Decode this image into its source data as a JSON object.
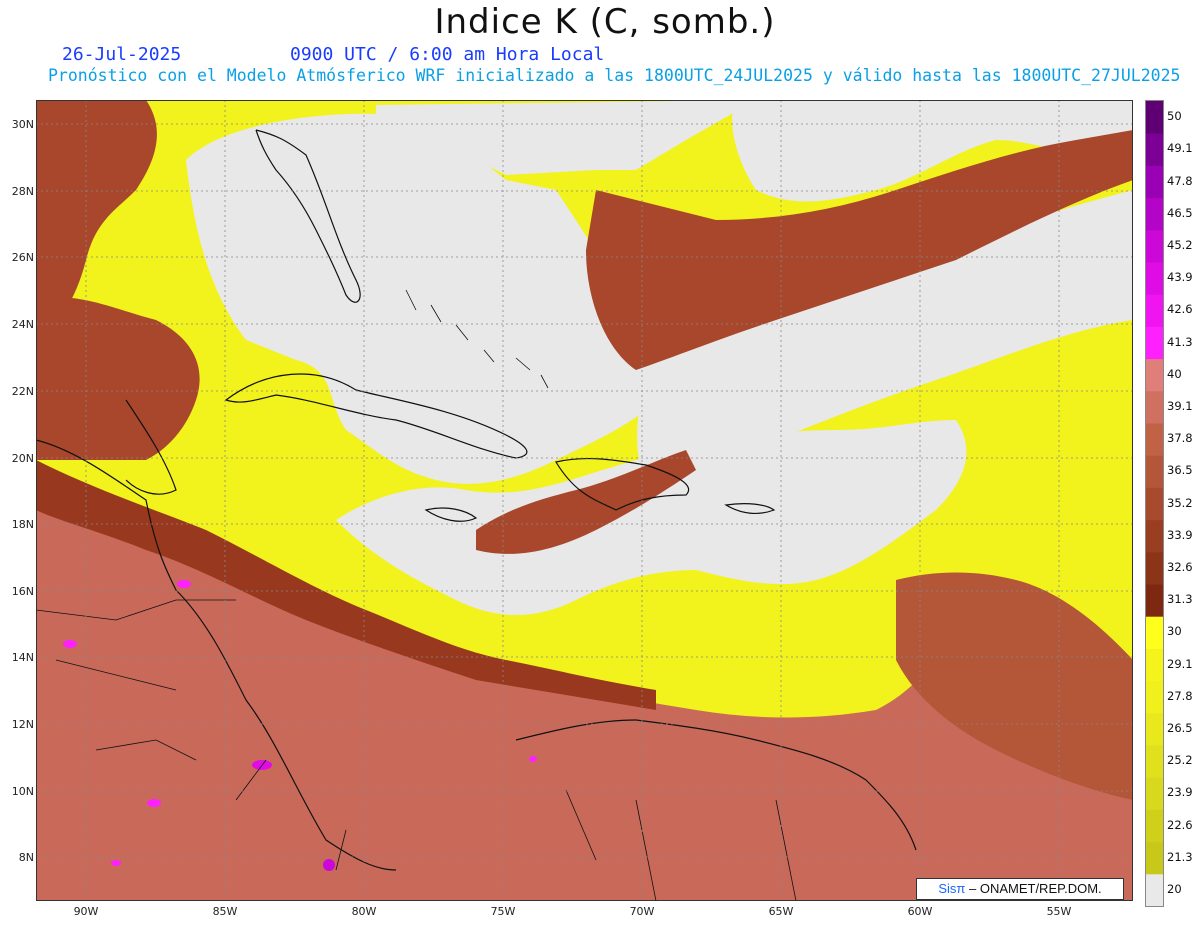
{
  "header": {
    "title": "Indice K (C, somb.)",
    "date": "26-Jul-2025",
    "time": "0900 UTC / 6:00 am Hora Local",
    "model": "Pronóstico con el Modelo Atmósferico WRF inicializado a las 1800UTC_24JUL2025 y válido hasta las  1800UTC_27JUL2025"
  },
  "map": {
    "lat_labels": [
      "30N",
      "28N",
      "26N",
      "24N",
      "22N",
      "20N",
      "18N",
      "16N",
      "14N",
      "12N",
      "10N",
      "8N"
    ],
    "lon_labels": [
      "90W",
      "85W",
      "80W",
      "75W",
      "70W",
      "65W",
      "60W",
      "55W"
    ],
    "extent": {
      "lon": [
        -92.0,
        -52.5
      ],
      "lat": [
        6.7,
        30.8
      ]
    },
    "grid": "dotted",
    "credit": {
      "logo": "Sis",
      "pi": "π",
      "text": " – ONAMET/REP.DOM."
    }
  },
  "colorbar": {
    "levels": [
      "20",
      "21.3",
      "22.6",
      "23.9",
      "25.2",
      "26.5",
      "27.8",
      "29.1",
      "30",
      "31.3",
      "32.6",
      "33.9",
      "35.2",
      "36.5",
      "37.8",
      "39.1",
      "40",
      "41.3",
      "42.6",
      "43.9",
      "45.2",
      "46.5",
      "47.8",
      "49.1",
      "50"
    ],
    "colors": [
      "#e9e9e9",
      "#c8c81a",
      "#d0d01a",
      "#d8d81c",
      "#e0e01c",
      "#e8e81c",
      "#f0f01c",
      "#f4f41c",
      "#ffff1e",
      "#7e2812",
      "#8c3418",
      "#9a3e22",
      "#a84a2c",
      "#b45638",
      "#c26244",
      "#cf7060",
      "#e07f7a",
      "#ff20ff",
      "#f014f0",
      "#e00ce6",
      "#cc08d8",
      "#b404c8",
      "#9a00b4",
      "#7c0096",
      "#5e0074"
    ],
    "accent": "#1a3cff",
    "secondary": "#0aa0e6"
  }
}
